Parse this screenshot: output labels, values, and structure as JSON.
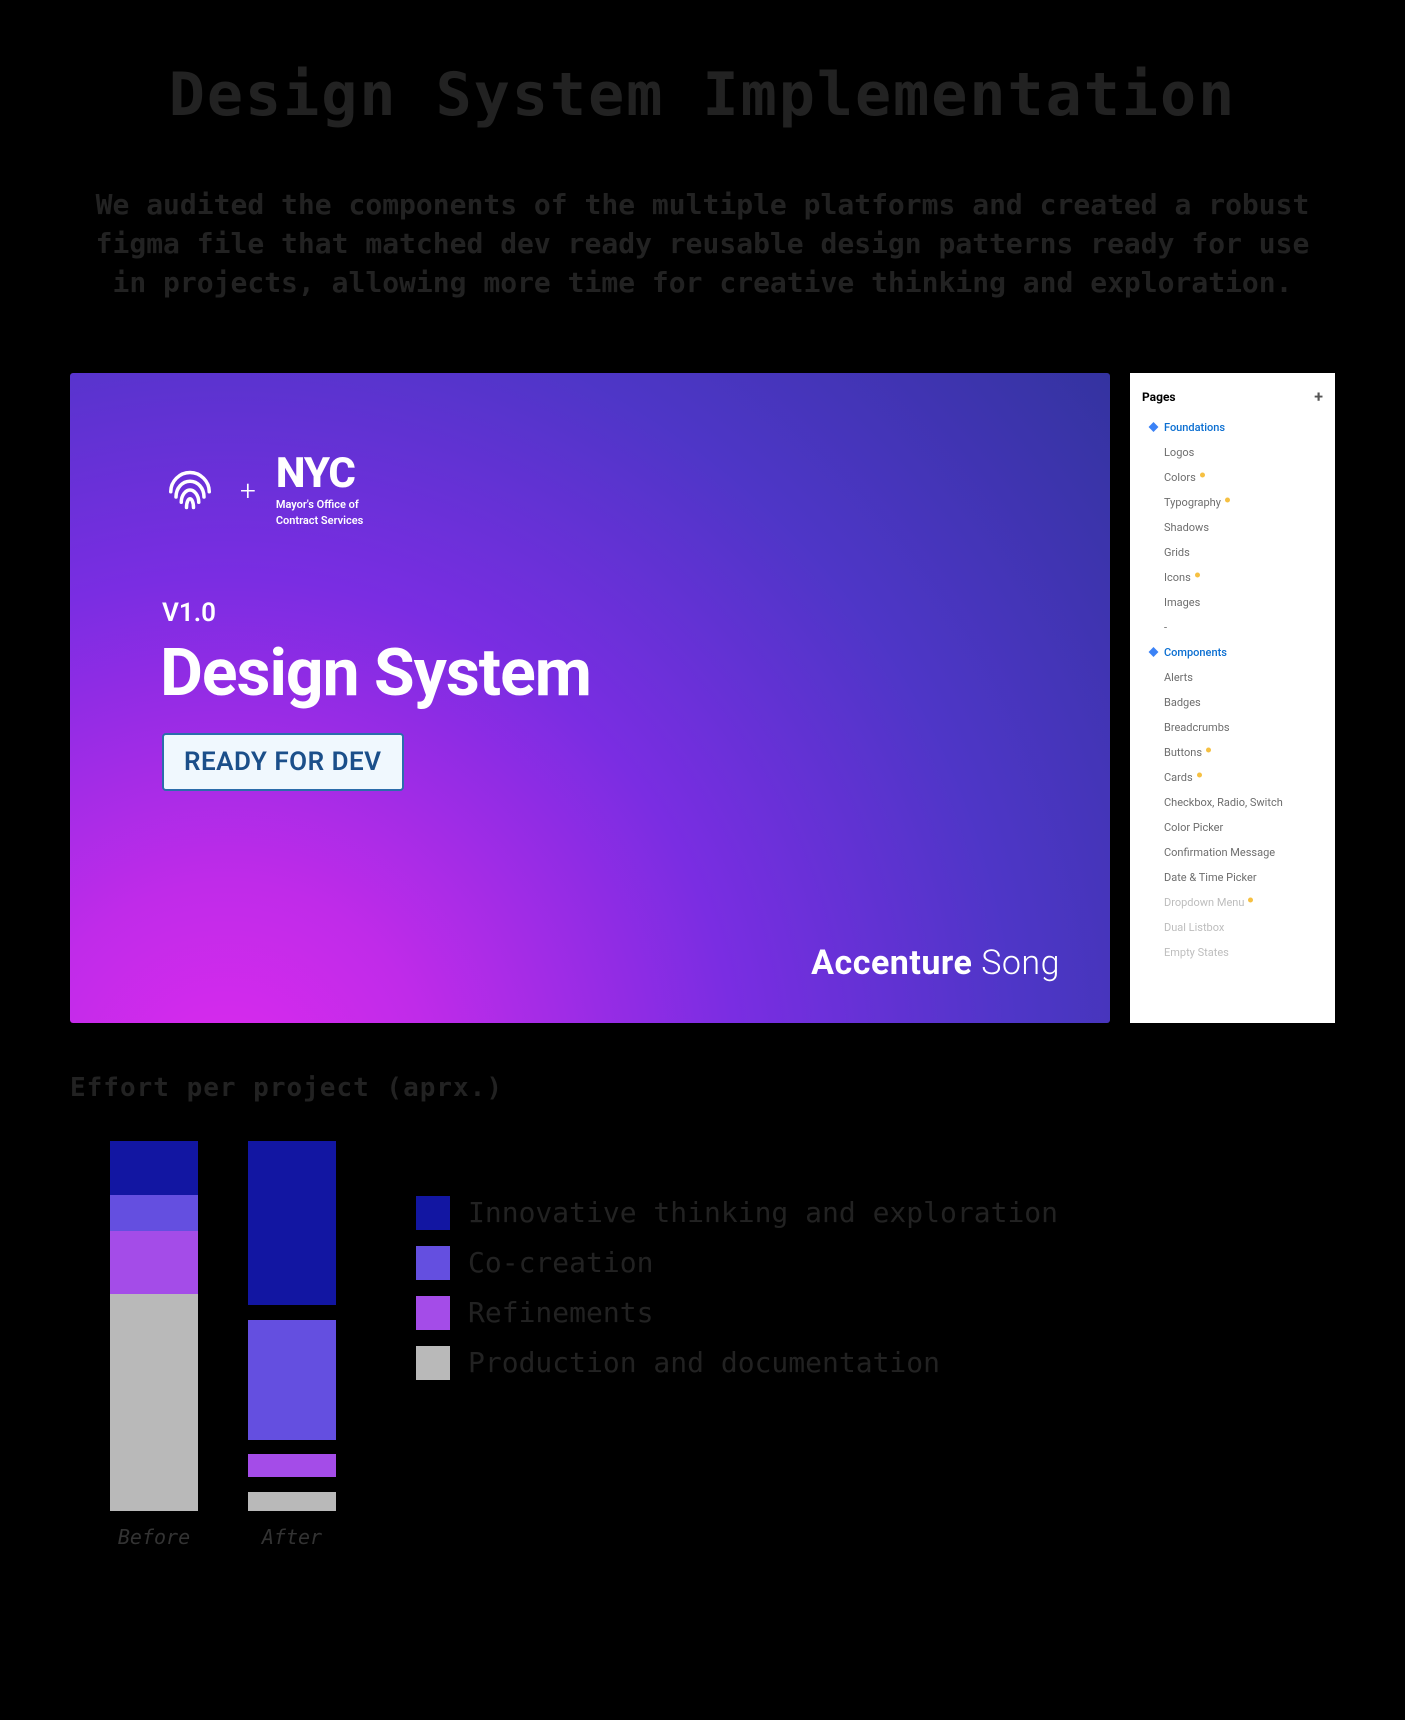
{
  "header": {
    "title": "Design System Implementation",
    "subtitle": "We audited the components of the multiple platforms and created a robust figma file that matched dev ready reusable design patterns ready for use in projects, allowing more time for creative thinking and exploration."
  },
  "cover": {
    "plus_glyph": "+",
    "nyc_title": "NYC",
    "nyc_sub1": "Mayor's Office of",
    "nyc_sub2": "Contract Services",
    "version": "V1.0",
    "title": "Design System",
    "badge": "READY FOR DEV",
    "brand_bold": "Accenture",
    "brand_light": " Song"
  },
  "pages": {
    "header": "Pages",
    "items": [
      {
        "label": "Foundations",
        "section": true
      },
      {
        "label": "Logos"
      },
      {
        "label": "Colors",
        "dot": true
      },
      {
        "label": "Typography",
        "dot": true
      },
      {
        "label": "Shadows"
      },
      {
        "label": "Grids"
      },
      {
        "label": "Icons",
        "dot": true
      },
      {
        "label": "Images"
      },
      {
        "label": "-"
      },
      {
        "label": "Components",
        "section": true
      },
      {
        "label": "Alerts"
      },
      {
        "label": "Badges"
      },
      {
        "label": "Breadcrumbs"
      },
      {
        "label": "Buttons",
        "dot": true
      },
      {
        "label": "Cards",
        "dot": true
      },
      {
        "label": "Checkbox, Radio, Switch"
      },
      {
        "label": "Color Picker"
      },
      {
        "label": "Confirmation Message"
      },
      {
        "label": "Date & Time Picker"
      },
      {
        "label": "Dropdown Menu",
        "dot": true,
        "dim": true
      },
      {
        "label": "Dual Listbox",
        "dim": true
      },
      {
        "label": "Empty States",
        "dim": true
      }
    ]
  },
  "chart_data": {
    "type": "bar",
    "title": "Effort per project (aprx.)",
    "stacked": true,
    "unit": "percent",
    "ylim": [
      0,
      100
    ],
    "categories": [
      "Before",
      "After"
    ],
    "series": [
      {
        "name": "Innovative thinking and exploration",
        "values": [
          12,
          44
        ],
        "color": "#1216a2"
      },
      {
        "name": "Co-creation",
        "values": [
          8,
          32
        ],
        "color": "#644fe0"
      },
      {
        "name": "Refinements",
        "values": [
          14,
          6
        ],
        "color": "#a44ce8"
      },
      {
        "name": "Production and documentation",
        "values": [
          48,
          5
        ],
        "color": "#b9b9b9"
      }
    ],
    "gaps": {
      "Before": [
        0,
        0,
        0,
        0
      ],
      "After": [
        0,
        4,
        4,
        4
      ]
    }
  }
}
